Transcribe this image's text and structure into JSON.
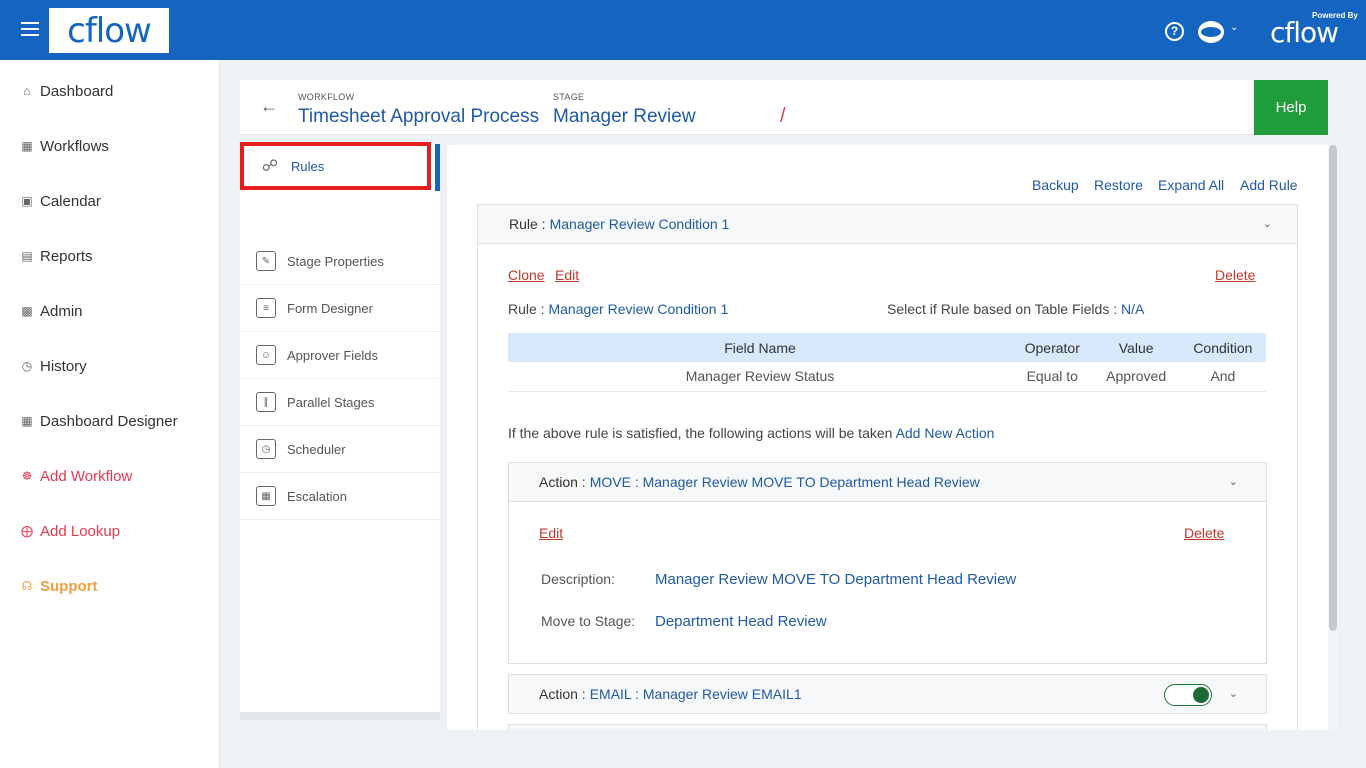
{
  "app": {
    "logo_text": "cflow",
    "powered_by": "Powered By",
    "powered_logo": "cflow",
    "help_icon": "?",
    "brand_color": "#1565c0"
  },
  "nav": {
    "items": [
      {
        "label": "Dashboard",
        "icon": "home-icon"
      },
      {
        "label": "Workflows",
        "icon": "grid-icon"
      },
      {
        "label": "Calendar",
        "icon": "calendar-icon"
      },
      {
        "label": "Reports",
        "icon": "report-icon"
      },
      {
        "label": "Admin",
        "icon": "admin-icon"
      },
      {
        "label": "History",
        "icon": "history-icon"
      },
      {
        "label": "Dashboard Designer",
        "icon": "dashboard-designer-icon"
      },
      {
        "label": "Add Workflow",
        "icon": "add-workflow-icon"
      },
      {
        "label": "Add Lookup",
        "icon": "add-lookup-icon"
      },
      {
        "label": "Support",
        "icon": "headset-icon"
      }
    ]
  },
  "header": {
    "workflow_label": "WORKFLOW",
    "workflow_name": "Timesheet Approval Process",
    "separator": "/",
    "stage_label": "STAGE",
    "stage_name": "Manager Review",
    "help_label": "Help"
  },
  "subnav": {
    "items": [
      {
        "label": "Rules",
        "icon": "share-icon"
      },
      {
        "label": "Stage Properties",
        "icon": "edit-icon"
      },
      {
        "label": "Form Designer",
        "icon": "form-icon"
      },
      {
        "label": "Approver Fields",
        "icon": "approver-icon"
      },
      {
        "label": "Parallel Stages",
        "icon": "parallel-icon"
      },
      {
        "label": "Scheduler",
        "icon": "scheduler-icon"
      },
      {
        "label": "Escalation",
        "icon": "escalation-icon"
      }
    ]
  },
  "main": {
    "top_links": {
      "backup": "Backup",
      "restore": "Restore",
      "expand_all": "Expand All",
      "add_rule": "Add Rule"
    },
    "rule": {
      "header_label": "Rule :",
      "header_name": "Manager Review Condition 1",
      "clone": "Clone",
      "edit": "Edit",
      "delete": "Delete",
      "rule_label": "Rule :",
      "rule_name": "Manager Review Condition 1",
      "table_fields_label": "Select if Rule based on Table Fields :",
      "table_fields_value": "N/A",
      "table": {
        "headers": [
          "Field Name",
          "Operator",
          "Value",
          "Condition"
        ],
        "rows": [
          [
            "Manager Review Status",
            "Equal to",
            "Approved",
            "And"
          ]
        ]
      },
      "satisfied_text": "If the above rule is satisfied, the following actions will be taken",
      "add_new_action": "Add New Action"
    },
    "actions": [
      {
        "label": "Action :",
        "value": "MOVE : Manager Review MOVE TO Department Head Review",
        "edit": "Edit",
        "delete": "Delete",
        "description_label": "Description:",
        "description_value": "Manager Review MOVE TO Department Head Review",
        "move_label": "Move to Stage:",
        "move_value": "Department Head Review"
      },
      {
        "label": "Action :",
        "value": "EMAIL : Manager Review EMAIL1",
        "enabled": true
      }
    ]
  }
}
